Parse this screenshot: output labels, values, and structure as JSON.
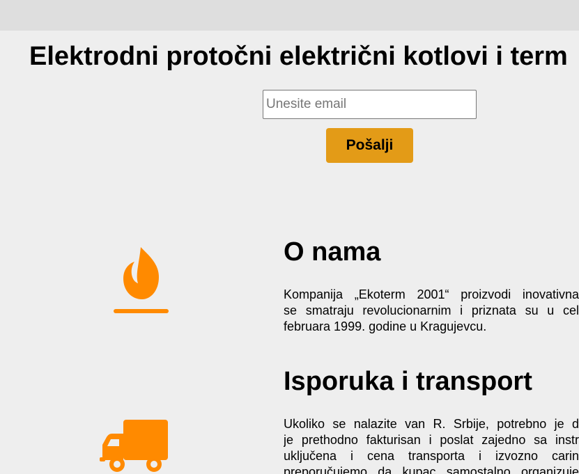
{
  "header": {
    "title": "Elektrodni protočni električni kotlovi i term"
  },
  "newsletter": {
    "email_placeholder": "Unesite email",
    "email_value": "",
    "send_label": "Pošalji"
  },
  "colors": {
    "accent": "#e39b17",
    "icon": "#ff8a00",
    "background": "#eeeeee"
  },
  "sections": [
    {
      "icon": "flame-icon",
      "title": "O nama",
      "lines": [
        "Kompanija „Ekoterm 2001“ proizvodi inovativna",
        "se smatraju revolucionarnim i priznata su u cel",
        "februara 1999. godine u Kragujevcu."
      ]
    },
    {
      "icon": "truck-icon",
      "title": "Isporuka i transport",
      "lines": [
        "Ukoliko se nalazite van R. Srbije, potrebno je d",
        "je prethodno fakturisan i poslat zajedno sa instr",
        "uključena i cena transporta i izvozno carin",
        "preporučujemo da kupac samostalno organizuje"
      ]
    }
  ]
}
